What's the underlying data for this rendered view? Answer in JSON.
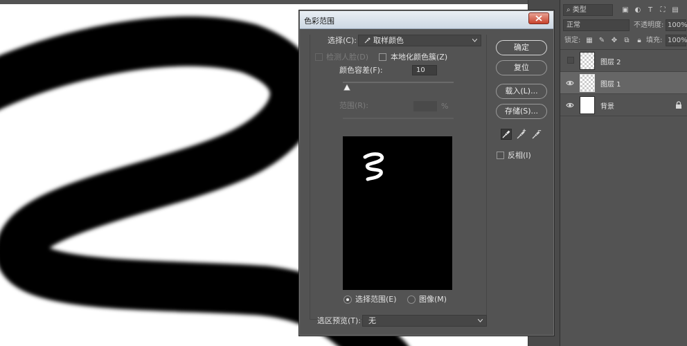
{
  "layers_panel": {
    "filter_kind": "类型",
    "blend_mode": "正常",
    "opacity_label": "不透明度:",
    "opacity_value": "100%",
    "lock_label": "锁定:",
    "fill_label": "填充:",
    "fill_value": "100%",
    "layers": [
      {
        "name": "图层 2",
        "visible": false,
        "selected": false
      },
      {
        "name": "图层 1",
        "visible": true,
        "selected": true
      },
      {
        "name": "背景",
        "visible": true,
        "selected": false,
        "locked": true
      }
    ]
  },
  "dialog": {
    "title": "色彩范围",
    "select_label": "选择(C):",
    "select_value": "取样颜色",
    "detect_faces_label": "检测人脸(D)",
    "localized_clusters_label": "本地化颜色簇(Z)",
    "fuzziness_label": "颜色容差(F):",
    "fuzziness_value": "10",
    "range_label": "范围(R):",
    "range_value": "",
    "range_unit": "%",
    "selection_radio_label": "选择范围(E)",
    "image_radio_label": "图像(M)",
    "selection_preview_label": "选区预览(T):",
    "selection_preview_value": "无",
    "buttons": {
      "ok": "确定",
      "reset": "复位",
      "load": "载入(L)...",
      "save": "存储(S)..."
    },
    "invert_label": "反相(I)",
    "tools": [
      "eyedropper-icon",
      "eyedropper-plus-icon",
      "eyedropper-minus-icon"
    ],
    "fuzziness_slider_fraction": 0.04
  }
}
